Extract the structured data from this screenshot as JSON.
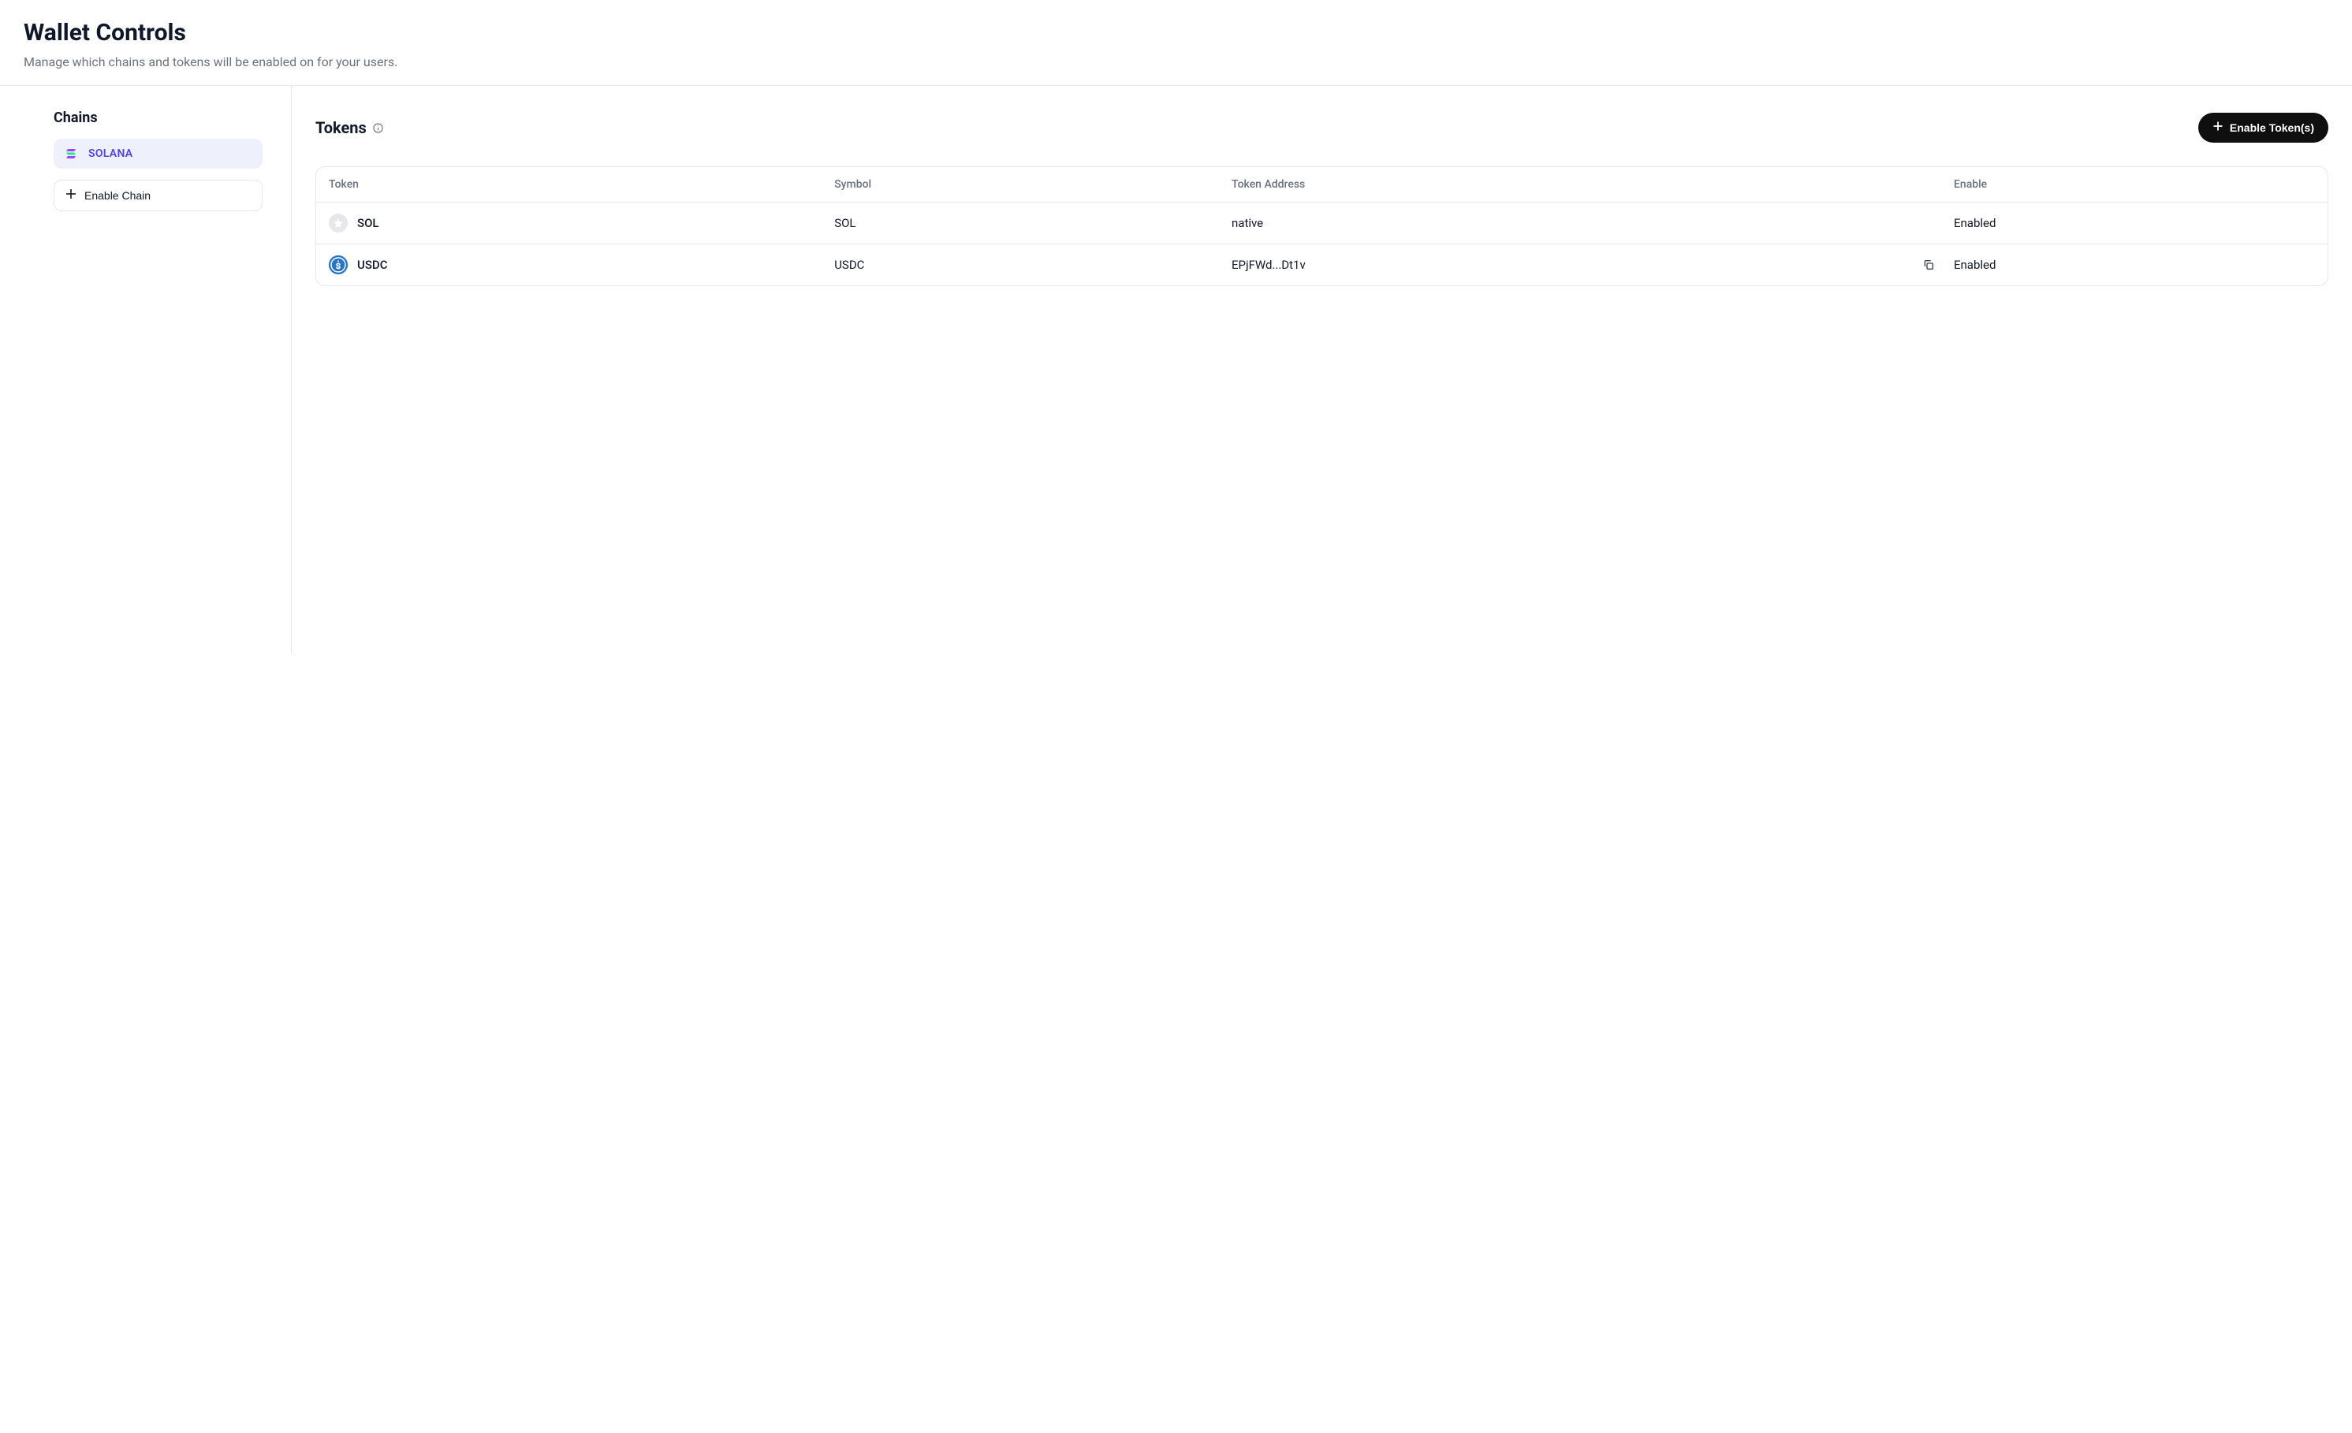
{
  "header": {
    "title": "Wallet Controls",
    "subtitle": "Manage which chains and tokens will be enabled on for your users."
  },
  "sidebar": {
    "title": "Chains",
    "chains": [
      {
        "name": "SOLANA",
        "active": true
      }
    ],
    "enable_chain_label": "Enable Chain"
  },
  "main": {
    "tokens_title": "Tokens",
    "enable_tokens_label": "Enable Token(s)",
    "table": {
      "columns": {
        "token": "Token",
        "symbol": "Symbol",
        "address": "Token Address",
        "enable": "Enable"
      },
      "rows": [
        {
          "name": "SOL",
          "symbol": "SOL",
          "address": "native",
          "enable": "Enabled",
          "icon": "star-grey",
          "copyable": false
        },
        {
          "name": "USDC",
          "symbol": "USDC",
          "address": "EPjFWd...Dt1v",
          "enable": "Enabled",
          "icon": "usdc-blue",
          "copyable": true
        }
      ]
    }
  }
}
